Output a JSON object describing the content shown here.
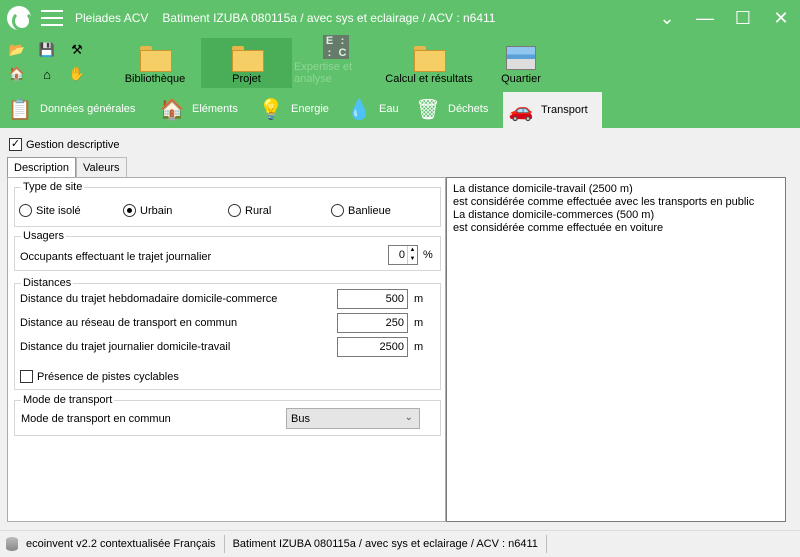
{
  "window": {
    "app_title": "Pleiades ACV",
    "document_title": "Batiment IZUBA 080115a / avec sys et eclairage / ACV : n6411",
    "controls": {
      "minimize": "—",
      "maximize": "☐",
      "close": "✕",
      "collapse": "⌄"
    }
  },
  "ribbon": {
    "buttons": [
      {
        "label": "Bibliothèque"
      },
      {
        "label": "Projet"
      },
      {
        "label": "Expertise et analyse"
      },
      {
        "label": "Calcul et résultats"
      },
      {
        "label": "Quartier"
      }
    ],
    "small_icons": [
      "open-folder-icon",
      "save-icon",
      "tools-icon",
      "home-icon",
      "settings-home-icon",
      "hand-icon"
    ]
  },
  "tabs": [
    {
      "label": "Données générales"
    },
    {
      "label": "Eléments"
    },
    {
      "label": "Energie"
    },
    {
      "label": "Eau"
    },
    {
      "label": "Déchets"
    },
    {
      "label": "Transport"
    }
  ],
  "content": {
    "gestion_label": "Gestion descriptive",
    "gestion_checked": true,
    "subtabs": [
      "Description",
      "Valeurs"
    ],
    "type_site": {
      "title": "Type de site",
      "options": [
        "Site isolé",
        "Urbain",
        "Rural",
        "Banlieue"
      ],
      "selected": "Urbain"
    },
    "usagers": {
      "title": "Usagers",
      "label": "Occupants effectuant le trajet journalier",
      "value": "0",
      "unit": "%"
    },
    "distances": {
      "title": "Distances",
      "rows": [
        {
          "label": "Distance du trajet hebdomadaire domicile-commerce",
          "value": "500",
          "unit": "m"
        },
        {
          "label": "Distance au réseau de transport en commun",
          "value": "250",
          "unit": "m"
        },
        {
          "label": "Distance du trajet journalier domicile-travail",
          "value": "2500",
          "unit": "m"
        }
      ],
      "pistes_label": "Présence de pistes cyclables",
      "pistes_checked": false
    },
    "mode_transport": {
      "title": "Mode de transport",
      "label": "Mode de transport en commun",
      "value": "Bus"
    },
    "summary": [
      "La distance domicile-travail (2500 m)",
      "est considérée comme effectuée avec les transports en public",
      "La distance domicile-commerces (500 m)",
      "est considérée comme effectuée en voiture"
    ]
  },
  "status": {
    "database": "ecoinvent v2.2 contextualisée Français",
    "document": "Batiment IZUBA 080115a / avec sys et eclairage / ACV : n6411"
  }
}
